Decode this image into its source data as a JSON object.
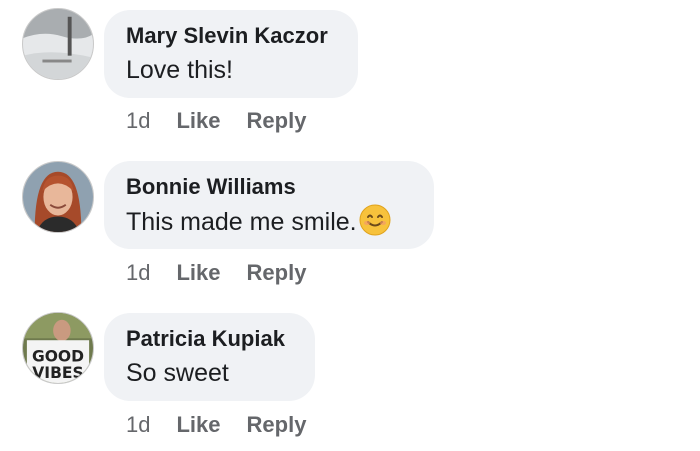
{
  "comments": [
    {
      "author": "Mary Slevin Kaczor",
      "text": "Love this!",
      "time": "1d",
      "like_label": "Like",
      "reply_label": "Reply"
    },
    {
      "author": "Bonnie Williams",
      "text": "This made me smile.",
      "emoji": "smiling-face-emoji",
      "time": "1d",
      "like_label": "Like",
      "reply_label": "Reply"
    },
    {
      "author": "Patricia Kupiak",
      "text": "So sweet",
      "avatar_text": [
        "GOOD",
        "VIBES"
      ],
      "time": "1d",
      "like_label": "Like",
      "reply_label": "Reply"
    }
  ]
}
